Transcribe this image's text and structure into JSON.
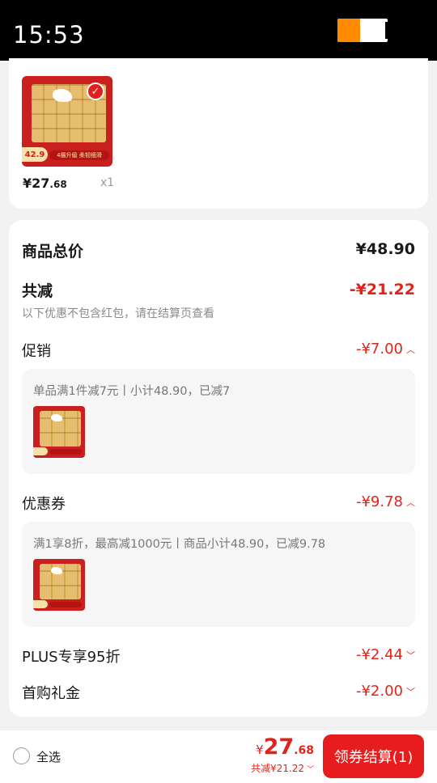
{
  "status_bar": {
    "time": "15:53",
    "battery_level": 0.45
  },
  "cart_item": {
    "price_currency": "¥",
    "price_int": "27",
    "price_dec": ".68",
    "quantity": "x1",
    "image": {
      "badge": "42.9",
      "strip": "4層升級 柔韧细滑",
      "check_icon": "check-icon"
    }
  },
  "summary": {
    "total_label": "商品总价",
    "total_value": "¥48.90",
    "reduction_label": "共减",
    "reduction_value": "-¥21.22",
    "note": "以下优惠不包含红包，请在结算页查看",
    "promotion": {
      "label": "促销",
      "value": "-¥7.00",
      "detail": "单品满1件减7元丨小计48.90，已减7"
    },
    "coupon": {
      "label": "优惠券",
      "value": "-¥9.78",
      "detail": "满1享8折，最高减1000元丨商品小计48.90，已减9.78"
    },
    "plus": {
      "label": "PLUS专享95折",
      "value": "-¥2.44"
    },
    "first_buy": {
      "label": "首购礼金",
      "value": "-¥2.00"
    }
  },
  "bottom_bar": {
    "select_all": "全选",
    "pay_currency": "¥",
    "pay_int": "27",
    "pay_dec": ".68",
    "saved": "共减¥21.22",
    "checkout_label": "领券结算(1)"
  },
  "colors": {
    "accent_red": "#e2231a",
    "button_red": "#e71d1d",
    "battery_fill": "#ff8c00"
  }
}
